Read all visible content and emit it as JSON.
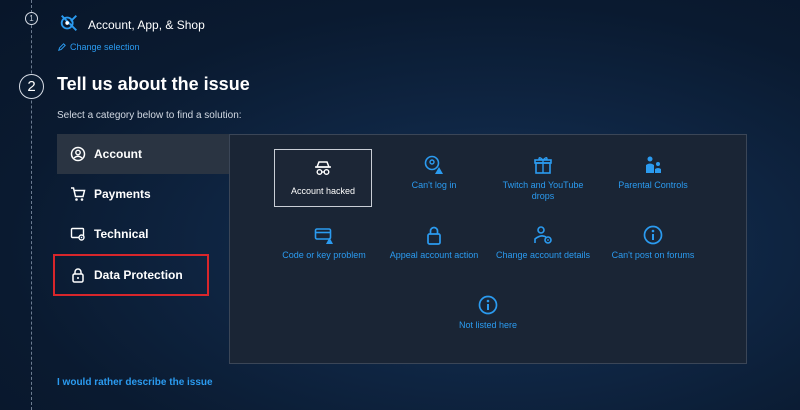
{
  "steps": {
    "one": "1",
    "two": "2"
  },
  "product": {
    "title": "Account, App, & Shop",
    "change_label": "Change selection"
  },
  "section": {
    "title": "Tell us about the issue",
    "instruction": "Select a category below to find a solution:"
  },
  "categories": [
    {
      "label": "Account",
      "icon": "user-circle-icon",
      "active": true
    },
    {
      "label": "Payments",
      "icon": "cart-icon"
    },
    {
      "label": "Technical",
      "icon": "monitor-gear-icon"
    },
    {
      "label": "Data Protection",
      "icon": "lock-icon",
      "highlighted": true
    }
  ],
  "options": [
    {
      "label": "Account hacked",
      "icon": "hacker-icon",
      "selected": true
    },
    {
      "label": "Can't log in",
      "icon": "user-alert-icon"
    },
    {
      "label": "Twitch and YouTube drops",
      "icon": "gift-icon"
    },
    {
      "label": "Parental Controls",
      "icon": "parent-child-icon"
    },
    {
      "label": "Code or key problem",
      "icon": "card-alert-icon"
    },
    {
      "label": "Appeal account action",
      "icon": "lock-icon"
    },
    {
      "label": "Change account details",
      "icon": "user-gear-icon"
    },
    {
      "label": "Can't post on forums",
      "icon": "info-icon"
    },
    {
      "label": "Not listed here",
      "icon": "info-icon"
    }
  ],
  "footer": {
    "describe_link": "I would rather describe the issue"
  },
  "colors": {
    "accent": "#2b9bf0",
    "highlight": "#d8262b",
    "panel": "#1a2535"
  }
}
